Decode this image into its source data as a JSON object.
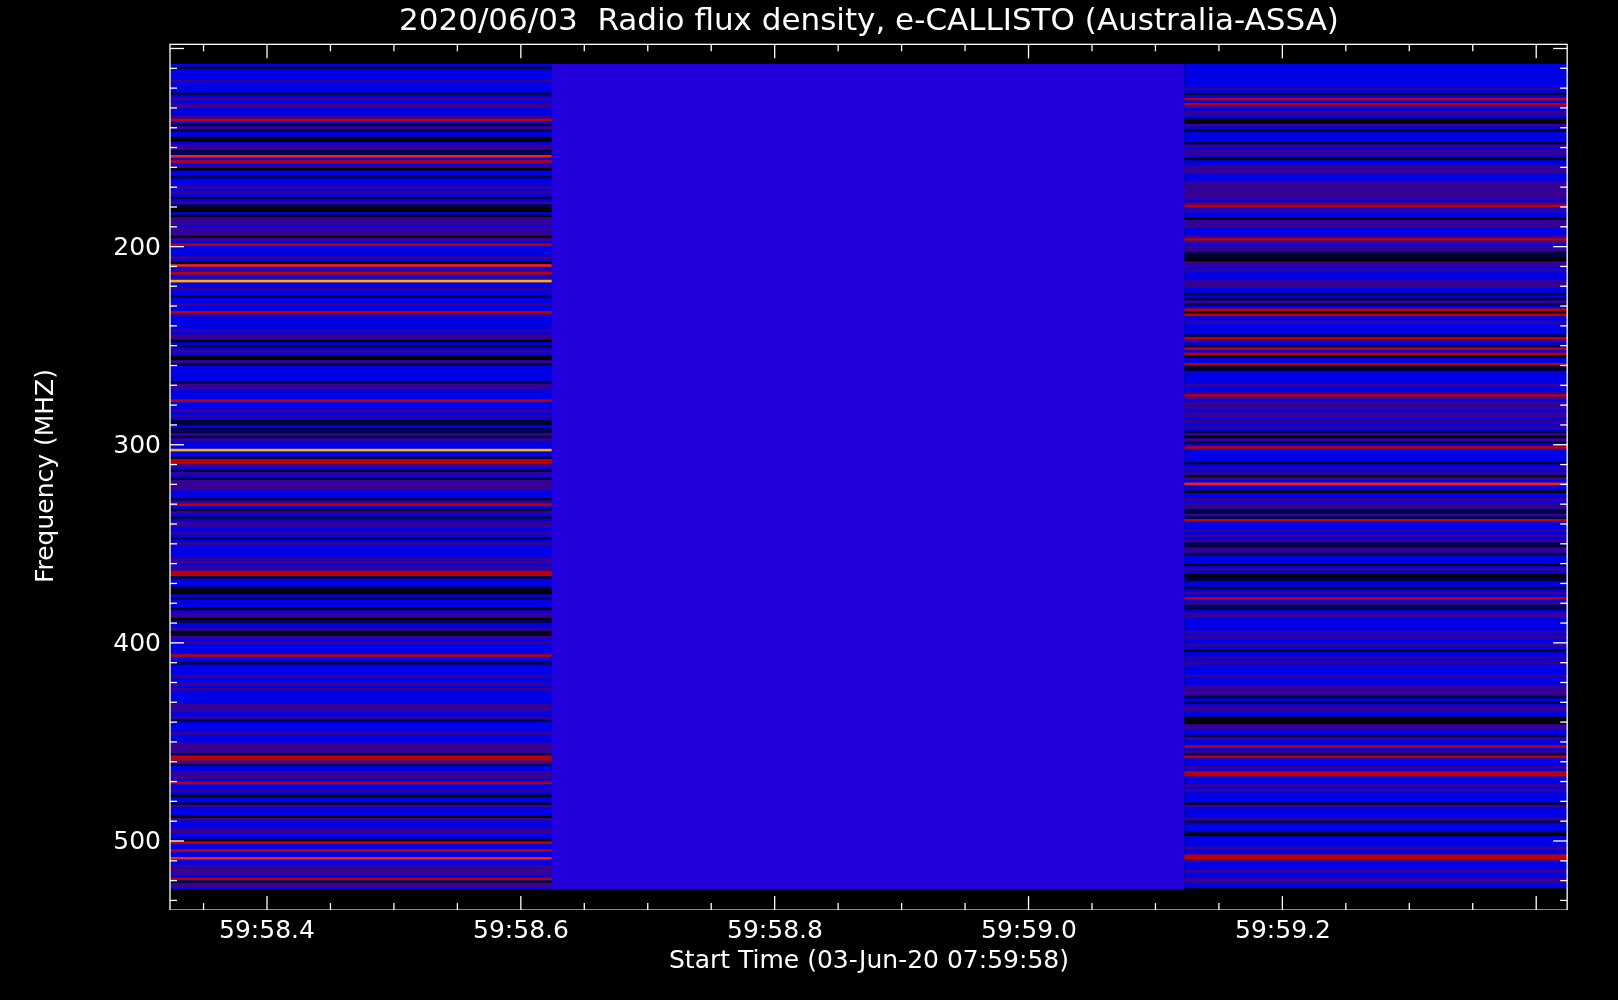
{
  "title": "2020/06/03  Radio flux density, e-CALLISTO (Australia-ASSA)",
  "plot": {
    "ylabel": "Frequency (MHZ)",
    "xlabel": "Start Time (03-Jun-20 07:59:58)",
    "yticks": [
      "200",
      "300",
      "400",
      "500"
    ],
    "xticks": [
      "59:58.4",
      "59:58.6",
      "59:58.8",
      "59:59.0",
      "59:59.2"
    ]
  }
}
